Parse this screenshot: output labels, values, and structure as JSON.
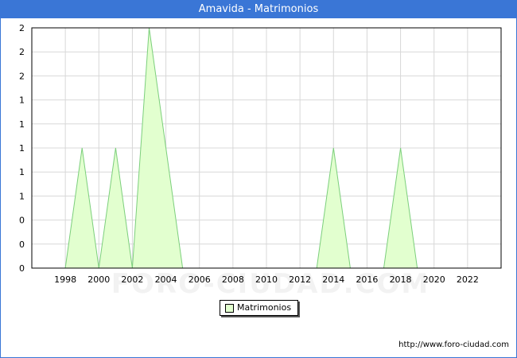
{
  "header": {
    "title": "Amavida - Matrimonios"
  },
  "watermark": "FORO-CIUDAD.COM",
  "footer": {
    "url": "http://www.foro-ciudad.com"
  },
  "colors": {
    "title_bar": "#3a76d6",
    "area_fill": "#e2ffcf",
    "area_line": "#7ccf7c",
    "grid": "#d8d8d8"
  },
  "chart_data": {
    "type": "area",
    "title": "Amavida - Matrimonios",
    "xlabel": "",
    "ylabel": "",
    "xlim": [
      1996,
      2024
    ],
    "ylim": [
      0,
      2
    ],
    "x_ticks": [
      1998,
      2000,
      2002,
      2004,
      2006,
      2008,
      2010,
      2012,
      2014,
      2016,
      2018,
      2020,
      2022
    ],
    "y_ticks": [
      0,
      0.2,
      0.4,
      0.6,
      0.8,
      1.0,
      1.2,
      1.4,
      1.6,
      1.8,
      2.0
    ],
    "y_tick_labels": [
      "0",
      "0",
      "0",
      "1",
      "1",
      "1",
      "1",
      "1",
      "2",
      "2",
      "2"
    ],
    "grid": true,
    "legend_position": "bottom-center",
    "series": [
      {
        "name": "Matrimonios",
        "x": [
          1998,
          1999,
          2000,
          2001,
          2002,
          2003,
          2004,
          2005,
          2006,
          2007,
          2008,
          2009,
          2010,
          2011,
          2012,
          2013,
          2014,
          2015,
          2016,
          2017,
          2018,
          2019,
          2020,
          2021,
          2022
        ],
        "values": [
          0,
          1,
          0,
          1,
          0,
          2,
          1,
          0,
          0,
          0,
          0,
          0,
          0,
          0,
          0,
          0,
          1,
          0,
          0,
          0,
          1,
          0,
          0,
          0,
          0
        ]
      }
    ]
  }
}
